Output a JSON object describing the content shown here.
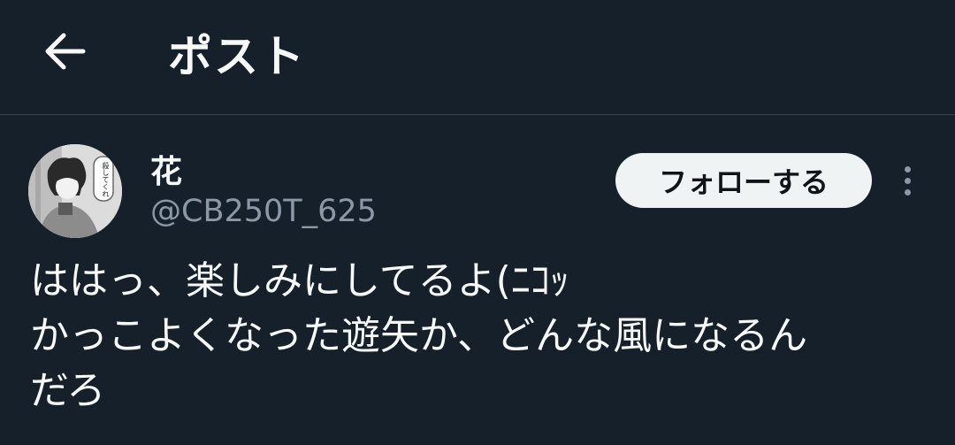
{
  "header": {
    "back_icon": "arrow-left-icon",
    "title": "ポスト"
  },
  "post": {
    "author": {
      "display_name": "花",
      "handle": "@CB250T_625",
      "avatar_caption": "殺してくれ"
    },
    "follow_label": "フォローする",
    "more_icon": "more-vertical-icon",
    "text": "ははっ、楽しみにしてるよ(ﾆｺｯ\nかっこよくなった遊矢か、どんな風になるん\nだろ"
  },
  "colors": {
    "background": "#15202b",
    "divider": "#38444d",
    "primary_text": "#f7f9f9",
    "secondary_text": "#8b98a5",
    "follow_button_bg": "#eff3f4",
    "follow_button_text": "#0f1419"
  }
}
